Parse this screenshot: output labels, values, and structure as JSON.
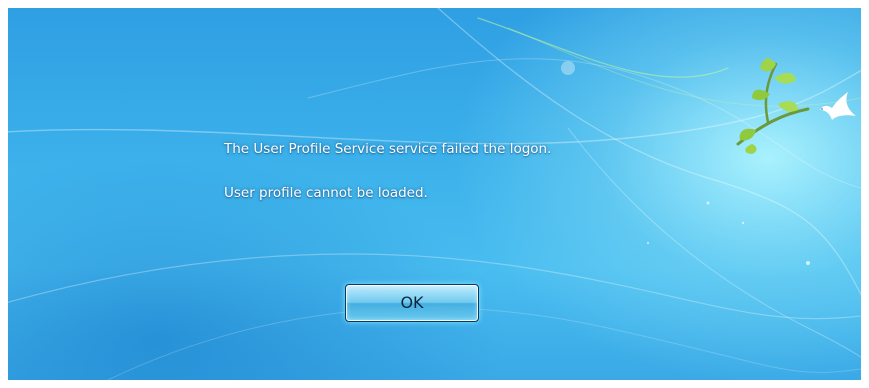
{
  "dialog": {
    "message_line1": "The User Profile Service service failed the logon.",
    "message_line2": "User profile cannot be loaded.",
    "ok_label": "OK"
  },
  "colors": {
    "background_primary": "#3bb0ea",
    "glow": "#aff5ff",
    "text": "#ffffff",
    "button_border": "#0b3a5e"
  },
  "decorations": {
    "logo": "windows7-bird-branch-icon"
  }
}
